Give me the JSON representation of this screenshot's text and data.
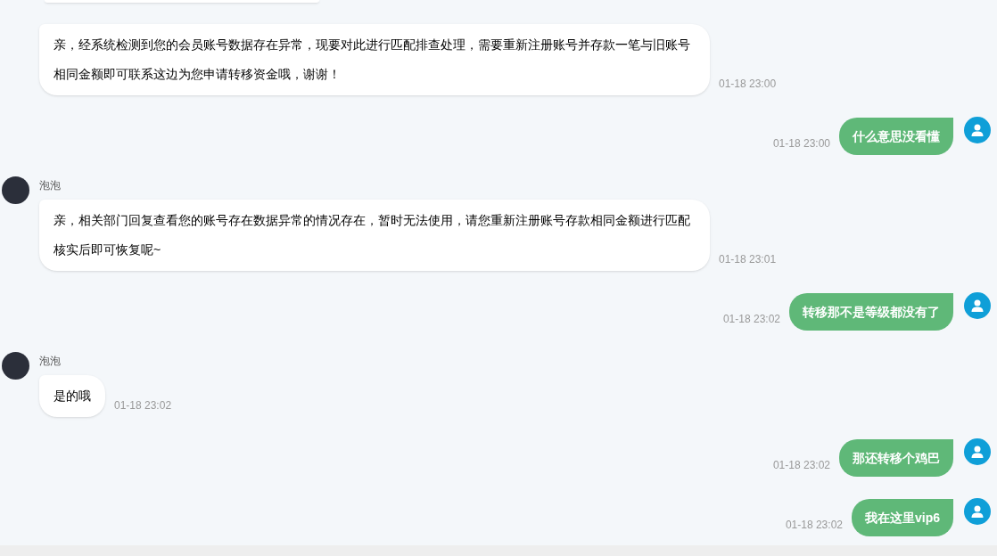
{
  "messages": [
    {
      "kind": "received",
      "text": "亲，经系统检测到您的会员账号数据存在异常，现要对此进行匹配排查处理，需要重新注册账号并存款一笔与旧账号相同金额即可联系这边为您申请转移资金哦，谢谢！",
      "time": "01-18 23:00"
    },
    {
      "kind": "sent",
      "text": "什么意思没看懂",
      "time": "01-18 23:00"
    },
    {
      "kind": "received",
      "sender": "泡泡",
      "text": "亲，相关部门回复查看您的账号存在数据异常的情况存在，暂时无法使用，请您重新注册账号存款相同金额进行匹配核实后即可恢复呢~",
      "time": "01-18 23:01"
    },
    {
      "kind": "sent",
      "text": "转移那不是等级都没有了",
      "time": "01-18 23:02"
    },
    {
      "kind": "received",
      "sender": "泡泡",
      "text": "是的哦",
      "time": "01-18 23:02"
    },
    {
      "kind": "sent",
      "text": "那还转移个鸡巴",
      "time": "01-18 23:02"
    },
    {
      "kind": "sent",
      "text": "我在这里vip6",
      "time": "01-18 23:02"
    }
  ]
}
